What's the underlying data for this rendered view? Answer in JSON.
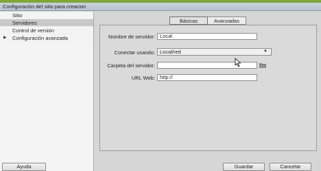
{
  "window": {
    "title": "Configuración del sitio para creacion"
  },
  "sidebar": {
    "items": [
      {
        "label": "Sitio",
        "selected": false,
        "expandable": false
      },
      {
        "label": "Servidores",
        "selected": true,
        "expandable": false
      },
      {
        "label": "Control de versión",
        "selected": false,
        "expandable": false
      },
      {
        "label": "Configuración avanzada",
        "selected": false,
        "expandable": true
      }
    ]
  },
  "tabs": [
    {
      "label": "Básicas",
      "active": true
    },
    {
      "label": "Avanzadas",
      "active": false
    }
  ],
  "form": {
    "server_name_label": "Nombre de servidor:",
    "server_name_value": "Local",
    "connect_label": "Conectar usando:",
    "connect_value": "Local/red",
    "server_folder_label": "Carpeta del servidor:",
    "server_folder_value": "",
    "url_label": "URL Web:",
    "url_value": "http://"
  },
  "buttons": {
    "help": "Ayuda",
    "save": "Guardar",
    "cancel": "Cancelar"
  },
  "colors": {
    "top_strip": "#7fa63b",
    "selected_item": "#c8c8c8"
  }
}
